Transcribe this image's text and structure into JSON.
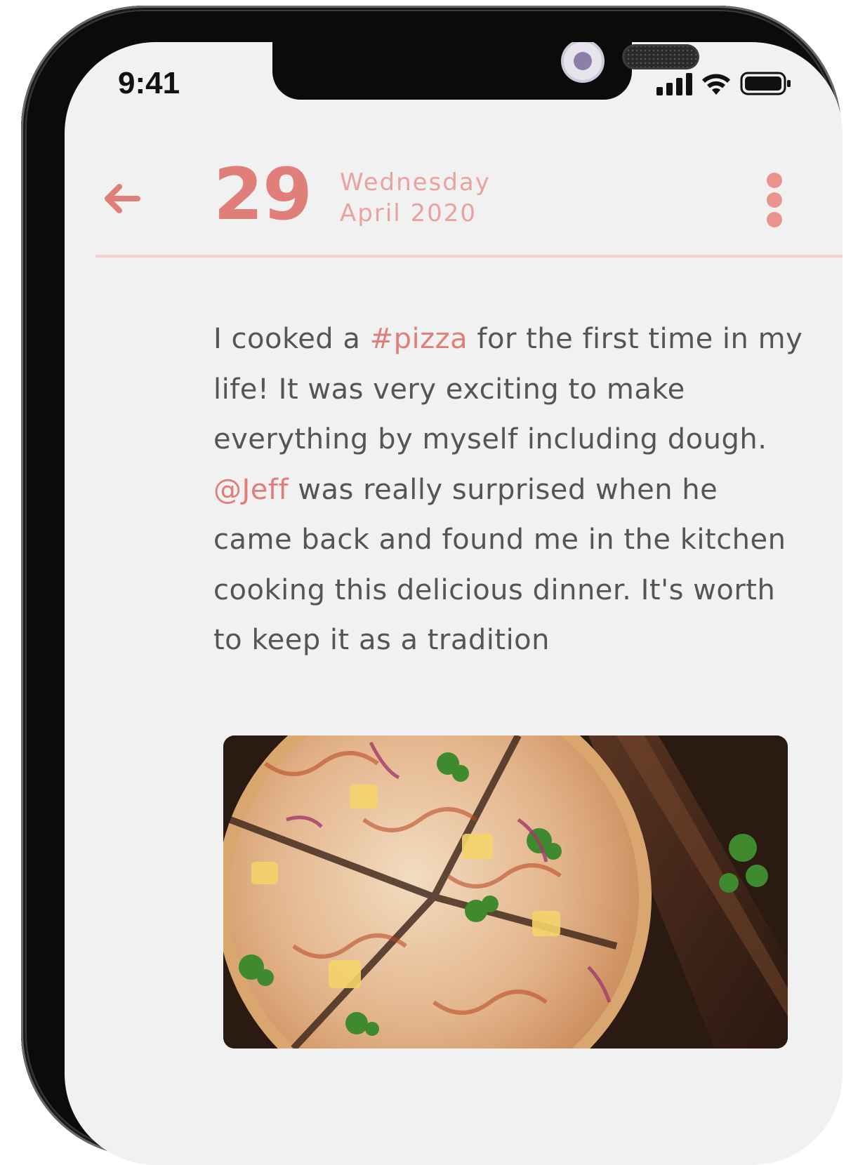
{
  "status_bar": {
    "time": "9:41"
  },
  "header": {
    "day": "29",
    "weekday": "Wednesday",
    "month_year": "April 2020"
  },
  "entry": {
    "segments": [
      {
        "text": "I cooked a ",
        "type": "text"
      },
      {
        "text": "#pizza",
        "type": "hashtag"
      },
      {
        "text": " for the first time in my life! It was very exciting to make everything by myself including dough. ",
        "type": "text"
      },
      {
        "text": "@Jeff",
        "type": "mention"
      },
      {
        "text": " was really surprised when he came back and found me in the kitchen cooking this delicious dinner. It's worth to keep it as a tradition",
        "type": "text"
      }
    ]
  },
  "colors": {
    "accent": "#e07f7a",
    "accent_light": "#e9a39f",
    "divider": "#f2d3d0",
    "body_text": "#555555",
    "background": "#f1f1f1"
  },
  "icons": {
    "back": "arrow-left-icon",
    "more": "more-vertical-icon",
    "signal": "cellular-signal-icon",
    "wifi": "wifi-icon",
    "battery": "battery-icon"
  }
}
